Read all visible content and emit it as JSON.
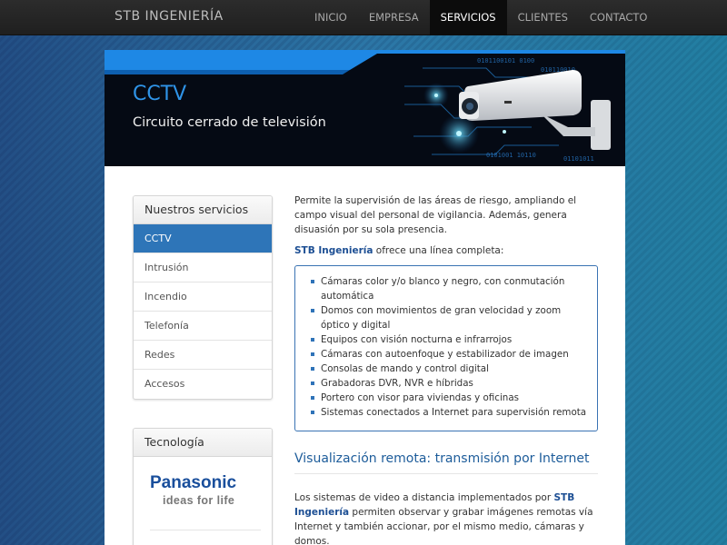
{
  "navbar": {
    "brand": "STB INGENIERÍA",
    "items": [
      {
        "label": "INICIO",
        "active": false
      },
      {
        "label": "EMPRESA",
        "active": false
      },
      {
        "label": "SERVICIOS",
        "active": true
      },
      {
        "label": "CLIENTES",
        "active": false
      },
      {
        "label": "CONTACTO",
        "active": false
      }
    ]
  },
  "hero": {
    "title": "CCTV",
    "subtitle": "Circuito cerrado de televisión",
    "title_color": "#2f94e8",
    "accent": "#1e88e5"
  },
  "sidebar": {
    "services_heading": "Nuestros servicios",
    "services": [
      {
        "label": "CCTV",
        "active": true
      },
      {
        "label": "Intrusión",
        "active": false
      },
      {
        "label": "Incendio",
        "active": false
      },
      {
        "label": "Telefonía",
        "active": false
      },
      {
        "label": "Redes",
        "active": false
      },
      {
        "label": "Accesos",
        "active": false
      }
    ],
    "tech_heading": "Tecnología",
    "tech_logo": {
      "name": "Panasonic",
      "tagline": "ideas for life",
      "color": "#1a4f9c"
    }
  },
  "main": {
    "intro": "Permite la supervisión de las áreas de riesgo, ampliando el campo visual del personal de vigilancia. Además, genera disuasión por su sola presencia.",
    "brand_name": "STB Ingeniería",
    "offer_text": " ofrece una línea completa:",
    "features": [
      "Cámaras color y/o blanco y negro, con conmutación automática",
      "Domos con movimientos de gran velocidad y zoom óptico y digital",
      "Equipos con visión nocturna e infrarrojos",
      "Cámaras con autoenfoque y estabilizador de imagen",
      "Consolas de mando y control digital",
      "Grabadoras DVR, NVR e híbridas",
      "Portero con visor para viviendas y oficinas",
      "Sistemas conectados a Internet para supervisión remota"
    ],
    "remote_heading": "Visualización remota: transmisión por Internet",
    "remote_text_before": "Los sistemas de video a distancia implementados por ",
    "remote_text_after": " permiten observar y grabar imágenes remotas vía Internet y también accionar, por el mismo medio, cámaras y domos."
  }
}
